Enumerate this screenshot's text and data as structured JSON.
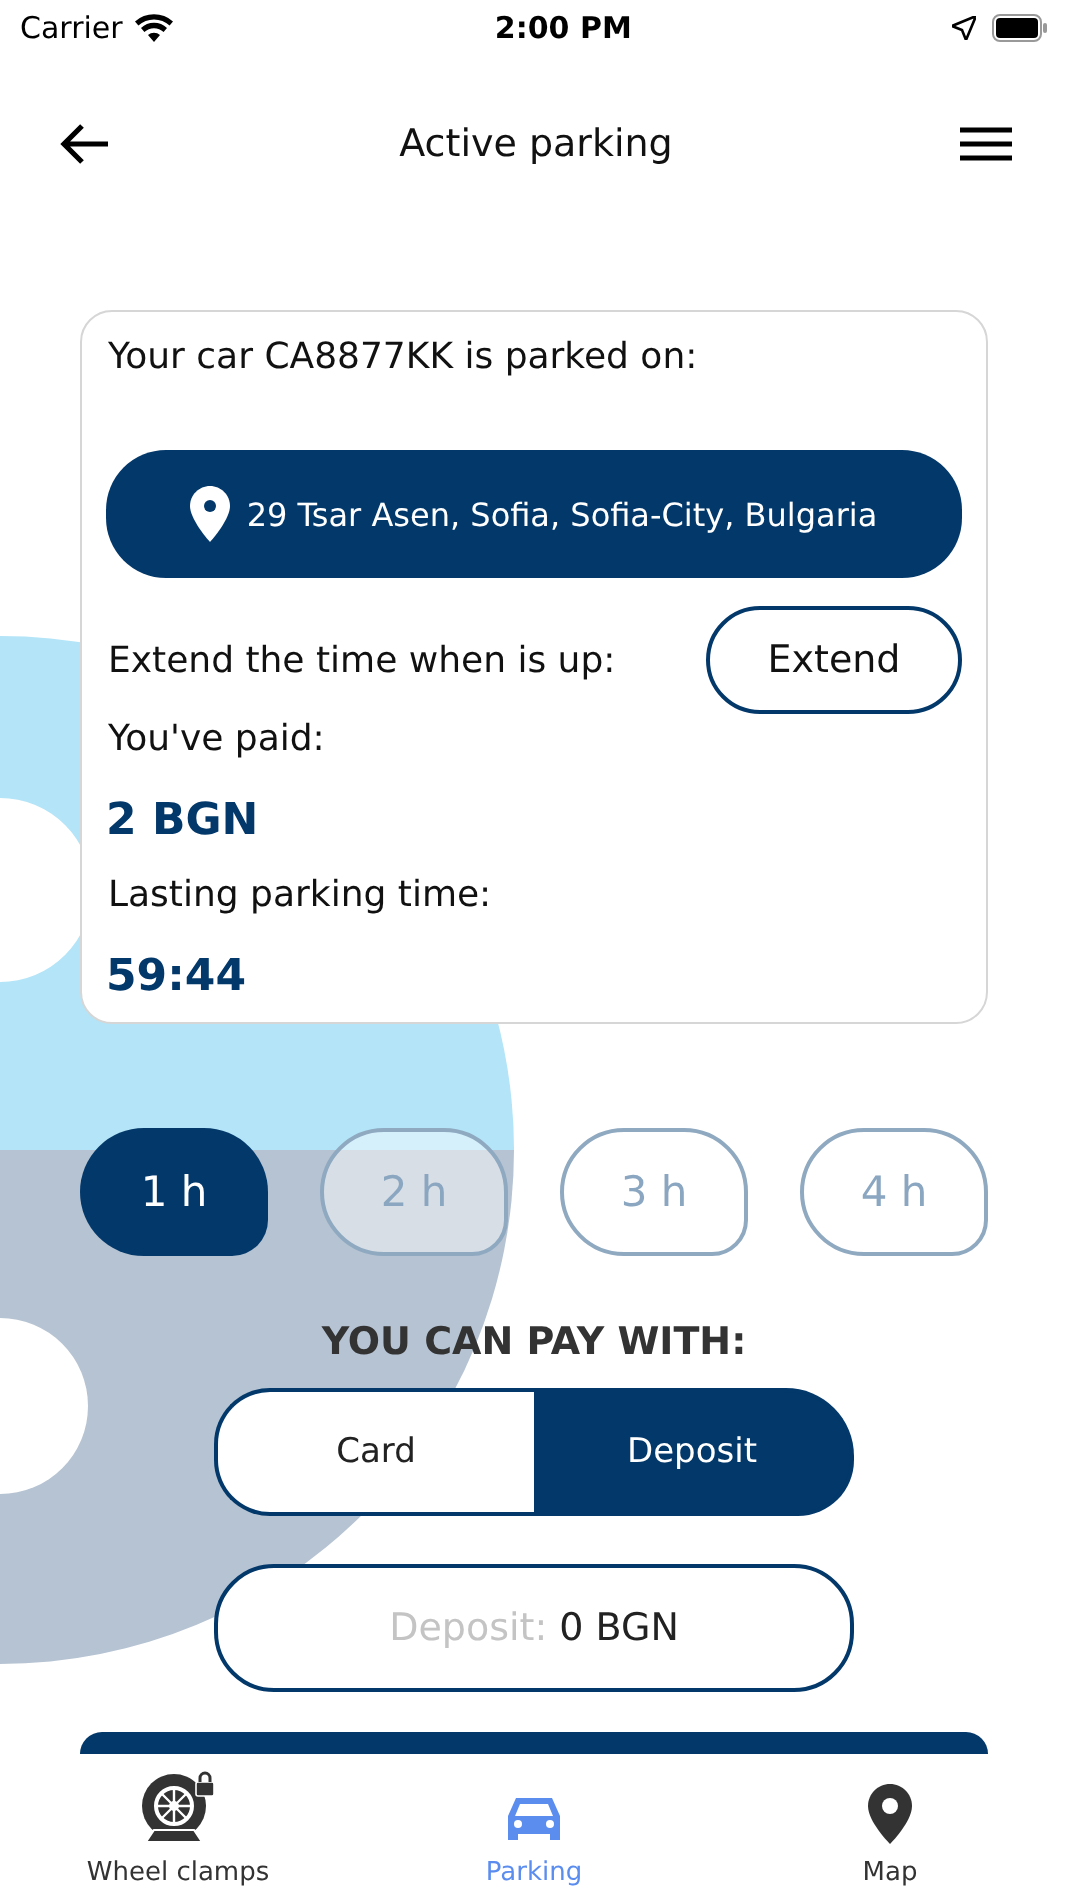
{
  "status_bar": {
    "carrier": "Carrier",
    "time": "2:00 PM"
  },
  "header": {
    "title": "Active parking"
  },
  "card": {
    "intro": "Your car CA8877KK is parked on:",
    "address": "29 Tsar Asen, Sofia, Sofia-City, Bulgaria",
    "extend_label": "Extend the time when is up:",
    "extend_button": "Extend",
    "paid_label": "You've paid:",
    "paid_amount": "2 BGN",
    "time_label": "Lasting parking time:",
    "time_left": "59:44"
  },
  "durations": [
    {
      "label": "1 h",
      "selected": true
    },
    {
      "label": "2 h",
      "selected": false
    },
    {
      "label": "3 h",
      "selected": false
    },
    {
      "label": "4 h",
      "selected": false
    }
  ],
  "payment": {
    "heading": "YOU CAN PAY WITH:",
    "methods": [
      {
        "label": "Card",
        "selected": false
      },
      {
        "label": "Deposit",
        "selected": true
      }
    ],
    "deposit_field": {
      "label": "Deposit:",
      "value": "0 BGN"
    }
  },
  "tab_bar": [
    {
      "kind": "clamp",
      "label": "Wheel clamps",
      "selected": false
    },
    {
      "kind": "car",
      "label": "Parking",
      "selected": true
    },
    {
      "kind": "pin",
      "label": "Map",
      "selected": false
    }
  ]
}
